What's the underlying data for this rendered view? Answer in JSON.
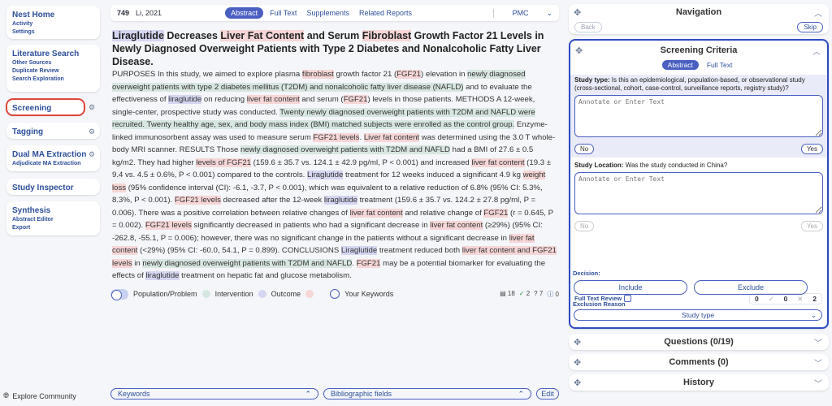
{
  "sidebar": {
    "groups": [
      {
        "title": "Nest Home",
        "subs": [
          "Activity",
          "Settings"
        ]
      },
      {
        "title": "Literature Search",
        "subs": [
          "Other Sources",
          "Duplicate Review",
          "Search Exploration"
        ]
      },
      {
        "title": "Screening",
        "subs": []
      },
      {
        "title": "Tagging",
        "subs": []
      },
      {
        "title": "Dual MA Extraction",
        "subs": [
          "Adjudicate MA Extraction"
        ]
      },
      {
        "title": "Study Inspector",
        "subs": []
      },
      {
        "title": "Synthesis",
        "subs": [
          "Abstract Editor",
          "Export"
        ]
      }
    ],
    "explore": "Explore Community"
  },
  "topbar": {
    "ref_id": "749",
    "ref_author": "Li, 2021",
    "tabs": [
      "Abstract",
      "Full Text",
      "Supplements",
      "Related Reports"
    ],
    "source": "PMC"
  },
  "article": {
    "title_parts": [
      {
        "t": "Liraglutide",
        "c": "int"
      },
      {
        "t": " Decreases ",
        "c": ""
      },
      {
        "t": "Liver Fat Content",
        "c": "out"
      },
      {
        "t": " and Serum ",
        "c": ""
      },
      {
        "t": "Fibroblast",
        "c": "out"
      },
      {
        "t": " Growth Factor 21 Levels in Newly Diagnosed Overweight Patients with Type 2 Diabetes and Nonalcoholic Fatty Liver Disease.",
        "c": ""
      }
    ],
    "body_parts": [
      {
        "t": "PURPOSES In this study, we aimed to explore plasma ",
        "c": ""
      },
      {
        "t": "fibroblast",
        "c": "out"
      },
      {
        "t": " growth factor 21 (",
        "c": ""
      },
      {
        "t": "FGF21",
        "c": "out"
      },
      {
        "t": ") elevation in ",
        "c": ""
      },
      {
        "t": "newly diagnosed overweight patients with type 2 diabetes mellitus (T2DM) and nonalcoholic fatty liver disease (NAFLD)",
        "c": "pop"
      },
      {
        "t": " and to evaluate the effectiveness of ",
        "c": ""
      },
      {
        "t": "liraglutide",
        "c": "int"
      },
      {
        "t": " on reducing ",
        "c": ""
      },
      {
        "t": "liver fat content",
        "c": "out"
      },
      {
        "t": " and serum (",
        "c": ""
      },
      {
        "t": "FGF21",
        "c": "out"
      },
      {
        "t": ") levels in those patients. METHODS A 12-week, single-center, prospective study was conducted. ",
        "c": ""
      },
      {
        "t": "Twenty newly diagnosed overweight patients with T2DM and NAFLD were recruited. Twenty healthy age, sex, and body mass index (BMI) matched subjects were enrolled as the control group.",
        "c": "pop"
      },
      {
        "t": " Enzyme-linked immunosorbent assay was used to measure serum ",
        "c": ""
      },
      {
        "t": "FGF21 levels",
        "c": "out"
      },
      {
        "t": ". ",
        "c": ""
      },
      {
        "t": "Liver fat content",
        "c": "out"
      },
      {
        "t": " was determined using the 3.0 T whole-body MRI scanner. RESULTS Those ",
        "c": ""
      },
      {
        "t": "newly diagnosed overweight patients with T2DM and NAFLD",
        "c": "pop"
      },
      {
        "t": " had a BMI of 27.6 ± 0.5 kg/m2. They had higher ",
        "c": ""
      },
      {
        "t": "levels of FGF21",
        "c": "out"
      },
      {
        "t": " (159.6 ± 35.7 vs. 124.1 ± 42.9 pg/ml, P < 0.001) and increased ",
        "c": ""
      },
      {
        "t": "liver fat content",
        "c": "out"
      },
      {
        "t": " (19.3 ± 9.4 vs. 4.5 ± 0.6%, P < 0.001) compared to the controls. ",
        "c": ""
      },
      {
        "t": "Liraglutide",
        "c": "int"
      },
      {
        "t": " treatment for 12 weeks induced a significant 4.9 kg ",
        "c": ""
      },
      {
        "t": "weight loss",
        "c": "out"
      },
      {
        "t": " (95% confidence interval (CI): -6.1, -3.7, P < 0.001), which was equivalent to a relative reduction of 6.8% (95% CI: 5.3%, 8.3%, P < 0.001). ",
        "c": ""
      },
      {
        "t": "FGF21 levels",
        "c": "out"
      },
      {
        "t": " decreased after the 12-week ",
        "c": ""
      },
      {
        "t": "liraglutide",
        "c": "int"
      },
      {
        "t": " treatment (159.6 ± 35.7 vs. 124.2 ± 27.8 pg/ml, P = 0.006). There was a positive correlation between relative changes of ",
        "c": ""
      },
      {
        "t": "liver fat content",
        "c": "out"
      },
      {
        "t": " and relative change of ",
        "c": ""
      },
      {
        "t": "FGF21",
        "c": "out"
      },
      {
        "t": " (r = 0.645, P = 0.002). ",
        "c": ""
      },
      {
        "t": "FGF21 levels",
        "c": "out"
      },
      {
        "t": " significantly decreased in patients who had a significant decrease in ",
        "c": ""
      },
      {
        "t": "liver fat content",
        "c": "out"
      },
      {
        "t": " (≥29%) (95% CI: -262.8, -55.1, P = 0.006); however, there was no significant change in the patients without a significant decrease in ",
        "c": ""
      },
      {
        "t": "liver fat content",
        "c": "out"
      },
      {
        "t": " (<29%) (95% CI: -60.0, 54.1, P = 0.899). CONCLUSIONS ",
        "c": ""
      },
      {
        "t": "Liraglutide",
        "c": "int"
      },
      {
        "t": " treatment reduced both ",
        "c": ""
      },
      {
        "t": "liver fat content and FGF21 levels",
        "c": "out"
      },
      {
        "t": " in ",
        "c": ""
      },
      {
        "t": "newly diagnosed overweight patients with T2DM and NAFLD",
        "c": "pop"
      },
      {
        "t": ". ",
        "c": ""
      },
      {
        "t": "FGF21",
        "c": "out"
      },
      {
        "t": " may be a potential biomarker for evaluating the effects of ",
        "c": ""
      },
      {
        "t": "liraglutide",
        "c": "int"
      },
      {
        "t": " treatment on hepatic fat and glucose metabolism.",
        "c": ""
      }
    ]
  },
  "legend": {
    "population": "Population/Problem",
    "intervention": "Intervention",
    "outcome": "Outcome",
    "keywords": "Your Keywords",
    "stats": [
      "18",
      "2",
      "7",
      "0"
    ]
  },
  "bottombar": {
    "keywords": "Keywords",
    "biblio": "Bibliographic fields",
    "edit": "Edit"
  },
  "navigation": {
    "title": "Navigation",
    "back": "Back",
    "skip": "Skip"
  },
  "criteria": {
    "title": "Screening Criteria",
    "tabs": [
      "Abstract",
      "Full Text"
    ],
    "q1_label": "Study type:",
    "q1_text": "Is this an epidemiological, population-based, or observational study (cross-sectional, cohort, case-control, surveillance reports, registry study)?",
    "q2_label": "Study Location:",
    "q2_text": "Was the study conducted in China?",
    "placeholder": "Annotate or Enter Text",
    "no": "No",
    "yes": "Yes",
    "full_text_review": "Full Text Review",
    "counts": [
      "0",
      "0",
      "2"
    ],
    "decision": "Decision:",
    "include": "Include",
    "exclude": "Exclude",
    "exclusion_reason": "Exclusion Reason",
    "reason_value": "Study type"
  },
  "collapsed": {
    "questions": "Questions (0/19)",
    "comments": "Comments (0)",
    "history": "History"
  },
  "colors": {
    "accent": "#4a5fc1",
    "population": "#d7e6e1",
    "intervention": "#d5d6f1",
    "outcome": "#f6d6d6",
    "highlight_border": "#2f4bc1",
    "active_nav": "#e0463a"
  }
}
